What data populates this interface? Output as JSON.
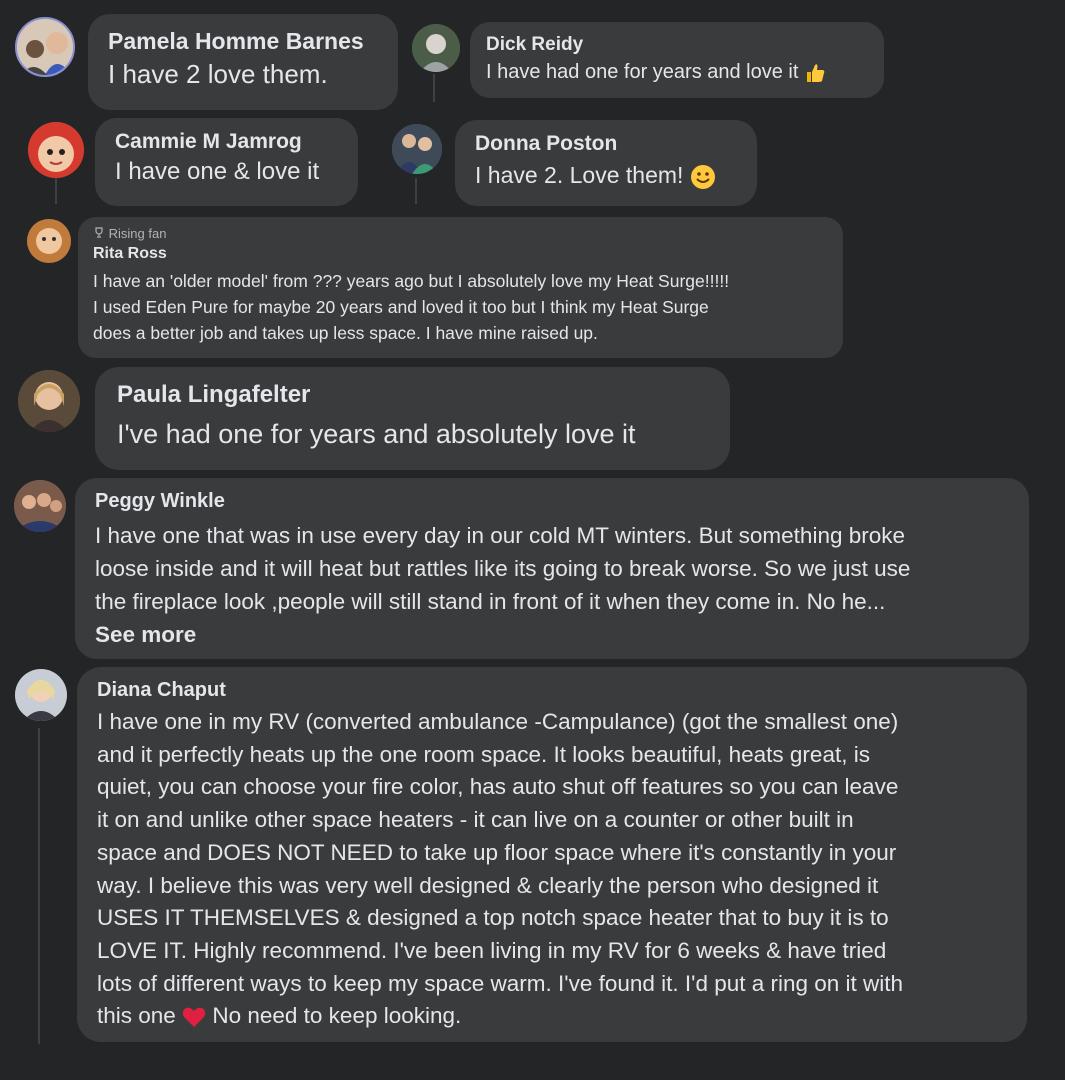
{
  "comments": [
    {
      "name": "Pamela Homme Barnes",
      "text": "I have 2 love them."
    },
    {
      "name": "Dick Reidy",
      "text": "I have had one for years and love it",
      "emoji": "thumbs-up"
    },
    {
      "name": "Cammie M Jamrog",
      "text": "I have one & love it"
    },
    {
      "name": "Donna Poston",
      "text": "I have 2. Love them!",
      "emoji": "smiley"
    },
    {
      "badge": "Rising fan",
      "name": "Rita Ross",
      "lines": [
        "I have an 'older model' from ??? years ago but I absolutely love my Heat Surge!!!!!",
        "I used Eden Pure for maybe 20 years and loved it too but I think my Heat Surge",
        "does a better job and takes up less space. I have mine raised up."
      ]
    },
    {
      "name": "Paula Lingafelter",
      "text": "I've had one for years and absolutely love it"
    },
    {
      "name": "Peggy Winkle",
      "lines": [
        "I have one that was in use every day in our cold MT winters. But something broke",
        "loose inside and it will heat but rattles like its going to break worse. So we just use",
        "the fireplace look ,people will still stand in front of it when they come in. No he..."
      ],
      "see_more": "See more"
    },
    {
      "name": "Diana Chaput",
      "lines": [
        "I have one in my RV (converted ambulance -Campulance) (got the smallest one)",
        "and it perfectly heats up the one room space. It looks beautiful, heats great, is",
        "quiet, you can choose your fire color, has auto shut off features so you can leave",
        "it on and unlike other space heaters - it can live on a counter or other built in",
        "space and DOES NOT NEED to take up floor space where it's constantly in your",
        "way. I believe this was very well designed & clearly the person who designed it",
        "USES IT THEMSELVES & designed a top notch space heater that to buy it is to",
        "LOVE IT. Highly recommend. I've been living in my RV for 6 weeks & have tried",
        "lots of different ways to keep my space warm. I've found it. I'd put a ring on it with",
        "this one"
      ],
      "last_line_tail": "No need to keep looking.",
      "emoji": "red-heart"
    }
  ]
}
